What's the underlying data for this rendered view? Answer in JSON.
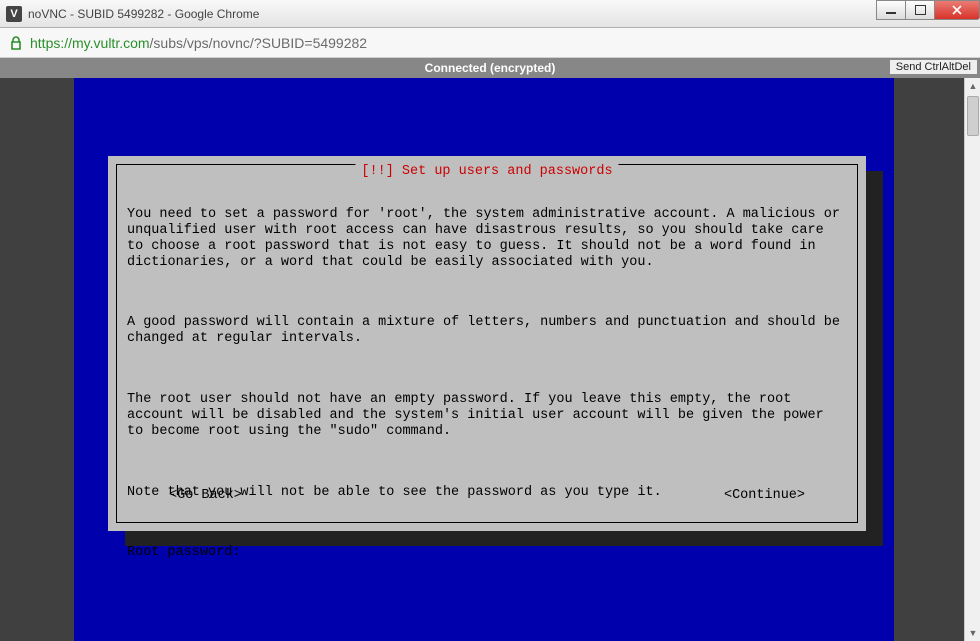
{
  "window": {
    "title": "noVNC - SUBID 5499282 - Google Chrome",
    "icon_letter": "V"
  },
  "address": {
    "scheme_host": "https://my.vultr.com",
    "path": "/subs/vps/novnc/?SUBID=5499282"
  },
  "vnc": {
    "status": "Connected (encrypted)",
    "send_cad": "Send CtrlAltDel"
  },
  "installer": {
    "title": "[!!] Set up users and passwords",
    "para1": "You need to set a password for 'root', the system administrative account. A malicious or unqualified user with root access can have disastrous results, so you should take care to choose a root password that is not easy to guess. It should not be a word found in dictionaries, or a word that could be easily associated with you.",
    "para2": "A good password will contain a mixture of letters, numbers and punctuation and should be changed at regular intervals.",
    "para3": "The root user should not have an empty password. If you leave this empty, the root account will be disabled and the system's initial user account will be given the power to become root using the \"sudo\" command.",
    "para4": "Note that you will not be able to see the password as you type it.",
    "prompt": "Root password:",
    "password_value": "",
    "go_back": "<Go Back>",
    "continue": "<Continue>"
  }
}
